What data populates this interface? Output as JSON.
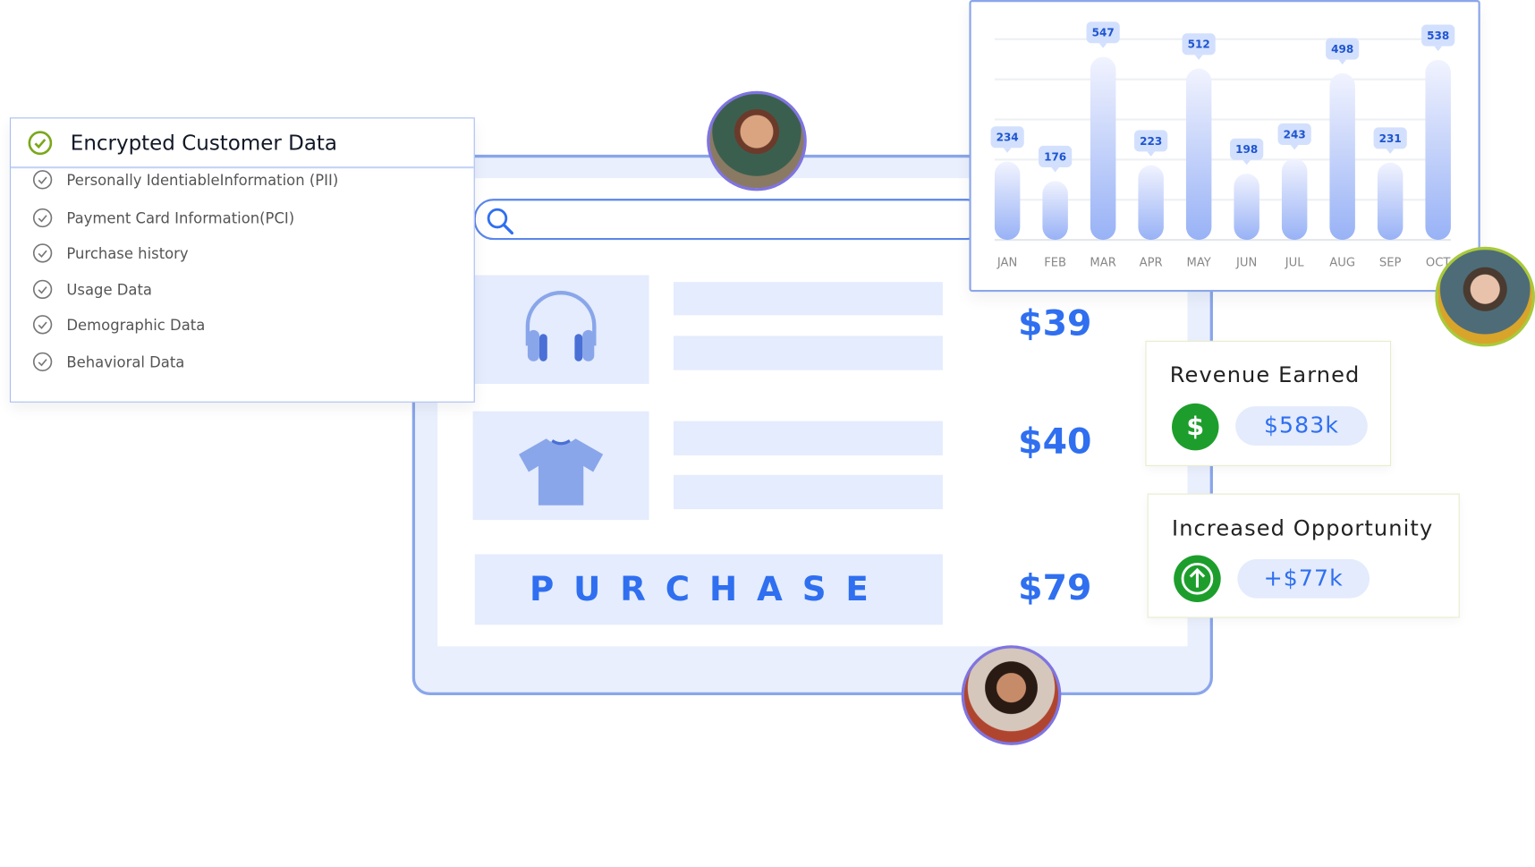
{
  "encrypted_card": {
    "title": "Encrypted Customer Data",
    "items": [
      "Personally IdentiableInformation (PII)",
      "Payment Card Information(PCI)",
      "Purchase  history",
      "Usage Data",
      "Demographic Data",
      "Behavioral Data"
    ]
  },
  "store": {
    "products": [
      {
        "icon": "headphones-icon",
        "price": "$39"
      },
      {
        "icon": "tshirt-icon",
        "price": "$40"
      }
    ],
    "purchase_label": "PURCHASE",
    "total_price": "$79"
  },
  "revenue_card": {
    "title": "Revenue Earned",
    "icon": "dollar-icon",
    "value": "$583k"
  },
  "opportunity_card": {
    "title": "Increased Opportunity",
    "icon": "arrow-up-icon",
    "value": "+$77k"
  },
  "colors": {
    "accent": "#2f6ff0",
    "frame": "#8aa6ea",
    "light_fill": "#e4ecfd",
    "green": "#1d9e2c",
    "check_green": "#7aa81a"
  },
  "chart_data": {
    "type": "bar",
    "categories": [
      "JAN",
      "FEB",
      "MAR",
      "APR",
      "MAY",
      "JUN",
      "JUL",
      "AUG",
      "SEP",
      "OCT"
    ],
    "values": [
      234,
      176,
      547,
      223,
      512,
      198,
      243,
      498,
      231,
      538
    ],
    "ylim": [
      0,
      600
    ],
    "grid": true,
    "data_labels": true
  }
}
